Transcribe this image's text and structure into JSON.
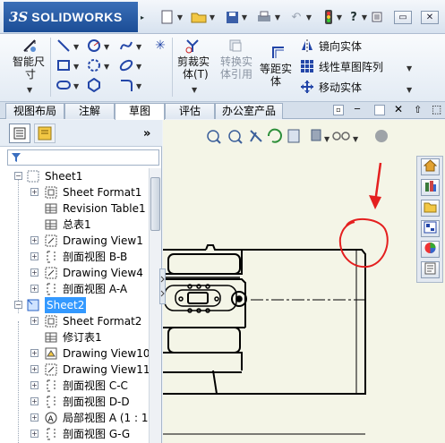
{
  "app": {
    "logo_ds": "3S",
    "logo_name": "SOLIDWORKS"
  },
  "ribbon": {
    "smart_dimension": "智能尺寸",
    "smart_dimension_l1": "智能尺",
    "smart_dimension_l2": "寸",
    "trim_l1": "剪裁实",
    "trim_l2": "体(T)",
    "convert_l1": "转换实",
    "convert_l2": "体引用",
    "offset_l1": "等距实",
    "offset_l2": "体",
    "mirror": "镜向实体",
    "linear_pattern": "线性草图阵列",
    "move": "移动实体"
  },
  "tabs": [
    "视图布局",
    "注解",
    "草图",
    "评估",
    "办公室产品"
  ],
  "active_tab": "草图",
  "tree": {
    "items": [
      {
        "label": "Sheet1"
      },
      {
        "label": "Sheet Format1"
      },
      {
        "label": "Revision Table1"
      },
      {
        "label": "总表1"
      },
      {
        "label": "Drawing View1"
      },
      {
        "label": "剖面视图 B-B"
      },
      {
        "label": "Drawing View4"
      },
      {
        "label": "剖面视图 A-A"
      },
      {
        "label": "Sheet2"
      },
      {
        "label": "Sheet Format2"
      },
      {
        "label": "修订表1"
      },
      {
        "label": "Drawing View10"
      },
      {
        "label": "Drawing View11"
      },
      {
        "label": "剖面视图 C-C"
      },
      {
        "label": "剖面视图 D-D"
      },
      {
        "label": "局部视图 A (1 : 1"
      },
      {
        "label": "剖面视图 G-G"
      }
    ]
  },
  "colors": {
    "annotation_red": "#e41f1f",
    "selection_blue": "#3399ff",
    "canvas_bg": "#f4f5e7"
  }
}
